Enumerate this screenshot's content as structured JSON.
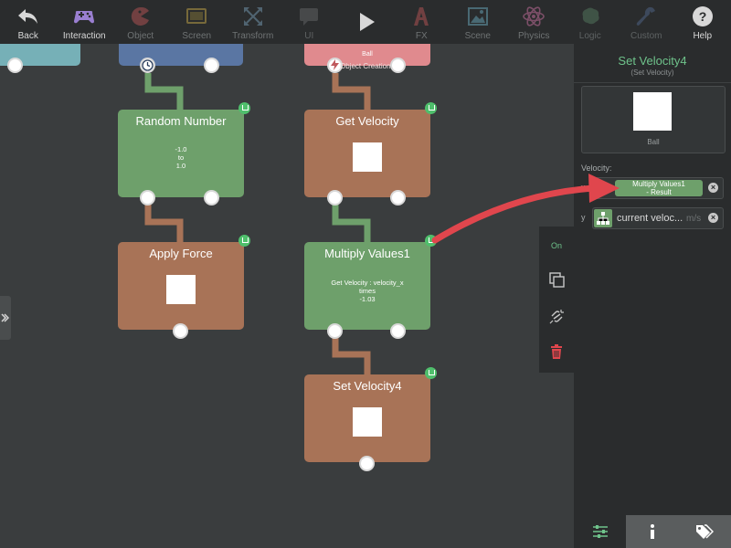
{
  "toolbar": {
    "items": [
      {
        "label": "Back",
        "icon": "back-arrow-icon",
        "state": "normal"
      },
      {
        "label": "Interaction",
        "icon": "gamepad-icon",
        "state": "normal"
      },
      {
        "label": "Object",
        "icon": "pacman-icon",
        "state": "muted"
      },
      {
        "label": "Screen",
        "icon": "screen-icon",
        "state": "muted"
      },
      {
        "label": "Transform",
        "icon": "transform-icon",
        "state": "muted"
      },
      {
        "label": "UI",
        "icon": "speech-bubble-icon",
        "state": "dim"
      },
      {
        "label": "",
        "icon": "play-icon",
        "state": "muted"
      },
      {
        "label": "FX",
        "icon": "fx-icon",
        "state": "muted"
      },
      {
        "label": "Scene",
        "icon": "image-icon",
        "state": "muted"
      },
      {
        "label": "Physics",
        "icon": "atom-icon",
        "state": "muted"
      },
      {
        "label": "Logic",
        "icon": "brain-icon",
        "state": "dim"
      },
      {
        "label": "Custom",
        "icon": "wrench-icon",
        "state": "dim"
      },
      {
        "label": "Help",
        "icon": "help-icon",
        "state": "normal"
      }
    ]
  },
  "nodes": {
    "ball": {
      "title": "Ball",
      "subtitle": "Object Creation"
    },
    "random_number": {
      "title": "Random Number",
      "line1": "-1.0",
      "line2": "to",
      "line3": "1.0"
    },
    "get_velocity": {
      "title": "Get Velocity"
    },
    "apply_force": {
      "title": "Apply Force"
    },
    "multiply_values": {
      "title": "Multiply Values1",
      "line1": "Get Velocity : velocity_x",
      "line2": "times",
      "line3": "-1.03"
    },
    "set_velocity": {
      "title": "Set Velocity4"
    }
  },
  "side_tools": {
    "on_label": "On"
  },
  "panel": {
    "title": "Set Velocity4",
    "subtitle": "(Set Velocity)",
    "preview_label": "Ball",
    "velocity_label": "Velocity:",
    "x_label": "x",
    "x_value_line1": "Multiply Values1",
    "x_value_line2": "- Result",
    "y_label": "y",
    "y_value": "current veloc...",
    "y_unit": "m/s"
  },
  "colors": {
    "accent_green": "#6fc38b",
    "node_green": "#6ea06b",
    "node_brown": "#a87357",
    "node_blue": "#5a76a3",
    "node_pink": "#e08a8e",
    "arrow_red": "#e0464d",
    "delete_red": "#e0464d"
  }
}
